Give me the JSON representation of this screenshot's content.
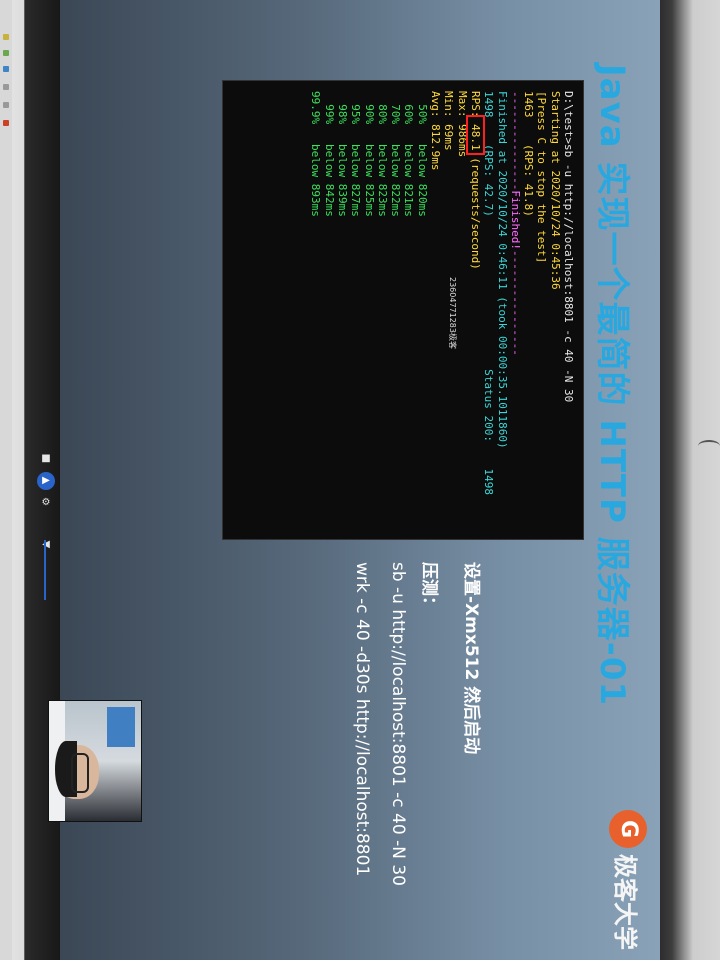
{
  "slide": {
    "title": "Java 实现一个最简的 HTTP 服务器-01",
    "logo_text": "极客大学",
    "bullets": [
      "设置-Xmx512 然后启动",
      "压测：",
      "sb -u http://localhost:8801 -c 40 -N 30",
      "wrk -c 40 -d30s http://localhost:8801"
    ]
  },
  "terminal": {
    "lines": [
      {
        "text": "D:\\test>sb -u http://localhost:8801 -c 40 -N 30",
        "color": "#e8e8e8"
      },
      {
        "text": "Starting at 2020/10/24 0:45:36",
        "color": "#ffd93b"
      },
      {
        "text": "[Press C to stop the test]",
        "color": "#ffd93b"
      },
      {
        "text": "1463    (RPS: 41.8)",
        "color": "#ffd93b"
      },
      {
        "text": "---------------Finished!----------------",
        "color": "#ff6cff"
      },
      {
        "text": "Finished at 2020/10/24 0:46:11 (took 00:00:35.1011860)",
        "color": "#3cd6d6"
      },
      {
        "text": "1498    (RPS: 42.7)                       Status 200:    1498",
        "color": "#3cd6d6"
      },
      {
        "text": "RPS: 48.1 (requests/second)",
        "color": "#ffd93b"
      },
      {
        "text": "Max: 986ms",
        "color": "#ffd93b"
      },
      {
        "text": "Min: 69ms",
        "color": "#ffd93b"
      },
      {
        "text": "Avg: 812.9ms",
        "color": "#ffd93b"
      },
      {
        "text": "",
        "color": "#e8e8e8"
      },
      {
        "text": "  50%   below 820ms",
        "color": "#3be05c"
      },
      {
        "text": "  60%   below 821ms",
        "color": "#3be05c"
      },
      {
        "text": "  70%   below 822ms",
        "color": "#3be05c"
      },
      {
        "text": "  80%   below 823ms",
        "color": "#3be05c"
      },
      {
        "text": "  90%   below 825ms",
        "color": "#3be05c"
      },
      {
        "text": "  95%   below 827ms",
        "color": "#3be05c"
      },
      {
        "text": "  98%   below 839ms",
        "color": "#3be05c"
      },
      {
        "text": "  99%   below 842ms",
        "color": "#3be05c"
      },
      {
        "text": "99.9%   below 893ms",
        "color": "#3be05c"
      }
    ],
    "highlight_value": "48.1",
    "watermark": "23604771283极客"
  },
  "player": {
    "icons": [
      "screen-icon",
      "play-icon",
      "settings-icon",
      "volume-icon"
    ]
  }
}
